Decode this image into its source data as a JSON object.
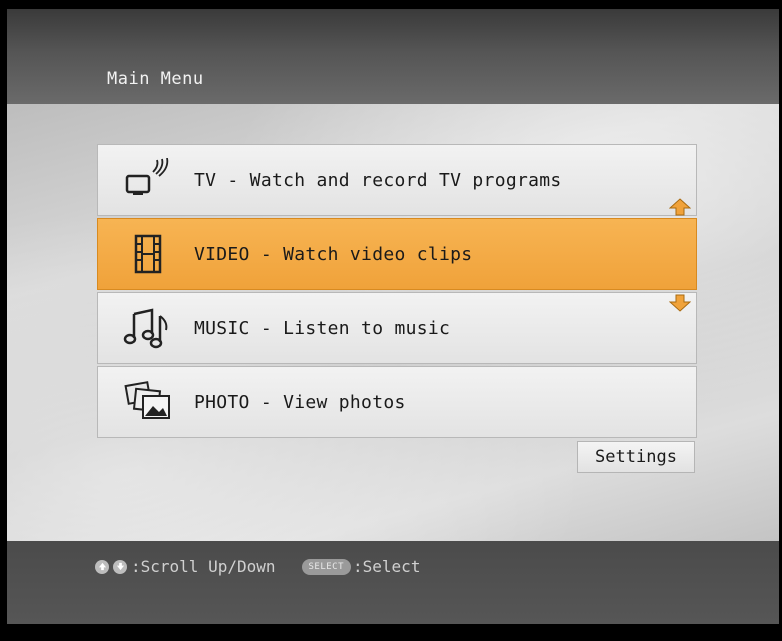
{
  "header": {
    "title": "Main Menu"
  },
  "menu": {
    "items": [
      {
        "label": "TV - Watch and record TV programs",
        "icon": "tv-icon"
      },
      {
        "label": "VIDEO - Watch video clips",
        "icon": "film-icon"
      },
      {
        "label": "MUSIC - Listen to music",
        "icon": "music-note-icon"
      },
      {
        "label": "PHOTO - View photos",
        "icon": "photo-icon"
      }
    ],
    "selected_index": 1,
    "settings_label": "Settings"
  },
  "footer": {
    "scroll_hint": ":Scroll Up/Down",
    "select_button": "SELECT",
    "select_hint": ":Select"
  },
  "colors": {
    "selected": "#f0a23a",
    "arrow": "#f0a23a"
  }
}
